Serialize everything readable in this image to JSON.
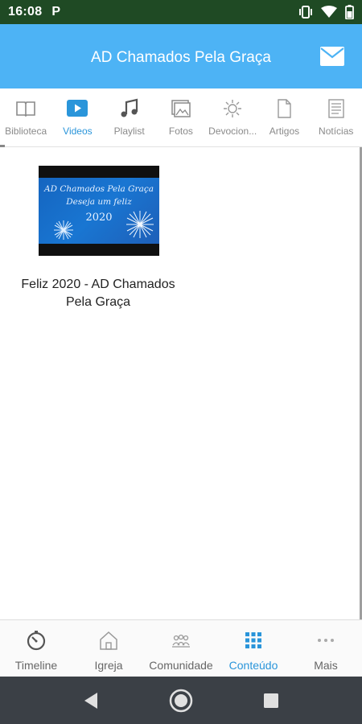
{
  "status_bar": {
    "time": "16:08",
    "app_indicator": "P",
    "icons": [
      "vibrate-icon",
      "wifi-icon",
      "battery-icon"
    ]
  },
  "app_bar": {
    "title": "AD Chamados Pela Graça",
    "action_icon": "mail-icon"
  },
  "tabs": [
    {
      "label": "Biblioteca",
      "icon": "book-icon",
      "active": false
    },
    {
      "label": "Videos",
      "icon": "play-icon",
      "active": true
    },
    {
      "label": "Playlist",
      "icon": "music-note-icon",
      "active": false
    },
    {
      "label": "Fotos",
      "icon": "photos-icon",
      "active": false
    },
    {
      "label": "Devocion...",
      "icon": "sun-icon",
      "active": false
    },
    {
      "label": "Artigos",
      "icon": "document-icon",
      "active": false
    },
    {
      "label": "Notícias",
      "icon": "news-icon",
      "active": false
    }
  ],
  "videos": [
    {
      "title": "Feliz 2020 - AD Chamados Pela Graça",
      "thumbnail_text": [
        "AD Chamados Pela Graça",
        "Deseja um feliz",
        "2020"
      ]
    }
  ],
  "bottom_nav": [
    {
      "label": "Timeline",
      "icon": "timer-icon",
      "active": false
    },
    {
      "label": "Igreja",
      "icon": "church-icon",
      "active": false
    },
    {
      "label": "Comunidade",
      "icon": "community-icon",
      "active": false
    },
    {
      "label": "Conteúdo",
      "icon": "grid-icon",
      "active": true
    },
    {
      "label": "Mais",
      "icon": "more-icon",
      "active": false
    }
  ],
  "colors": {
    "status_bar": "#1f4a24",
    "app_bar": "#4db3f5",
    "accent": "#2a95da",
    "system_nav": "#3b4046"
  }
}
